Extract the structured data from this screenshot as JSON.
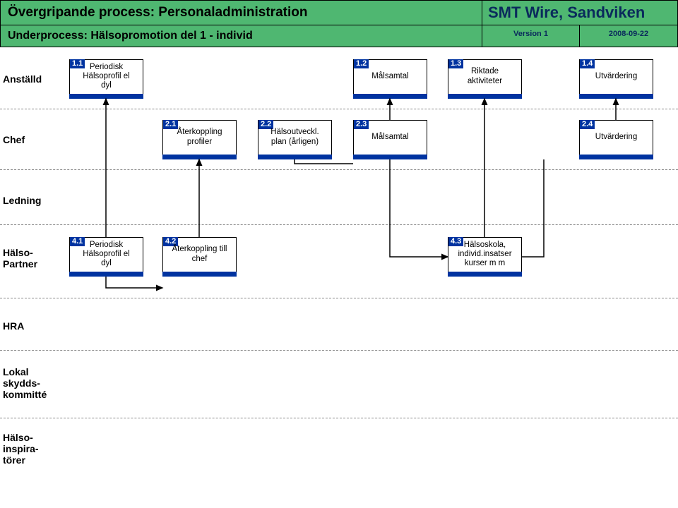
{
  "header": {
    "process": "Övergripande process: Personaladministration",
    "company": "SMT Wire, Sandviken",
    "subprocess": "Underprocess: Hälsopromotion del 1 - individ",
    "version": "Version 1",
    "date": "2008-09-22"
  },
  "lanes": {
    "l0": "Anställd",
    "l1": "Chef",
    "l2": "Ledning",
    "l3": "Hälso-\nPartner",
    "l4": "HRA",
    "l5": "Lokal\nskydds-\nkommitté",
    "l6": "Hälso-\ninspira-\ntörer"
  },
  "boxes": {
    "b11": {
      "id": "1.1",
      "txt": "Periodisk\nHälsoprofil el\ndyl"
    },
    "b12": {
      "id": "1.2",
      "txt": "Målsamtal"
    },
    "b13": {
      "id": "1.3",
      "txt": "Riktade\naktiviteter"
    },
    "b14": {
      "id": "1.4",
      "txt": "Utvärdering"
    },
    "b21": {
      "id": "2.1",
      "txt": "Återkoppling\nprofiler"
    },
    "b22": {
      "id": "2.2",
      "txt": "Hälsoutveckl.\nplan (årligen)"
    },
    "b23": {
      "id": "2.3",
      "txt": "Målsamtal"
    },
    "b24": {
      "id": "2.4",
      "txt": "Utvärdering"
    },
    "b41": {
      "id": "4.1",
      "txt": "Periodisk\nHälsoprofil el\ndyl"
    },
    "b42": {
      "id": "4.2",
      "txt": "Återkoppling till\nchef"
    },
    "b43": {
      "id": "4.3",
      "txt": "Hälsoskola,\nindivid.insatser\nkurser m m"
    }
  }
}
